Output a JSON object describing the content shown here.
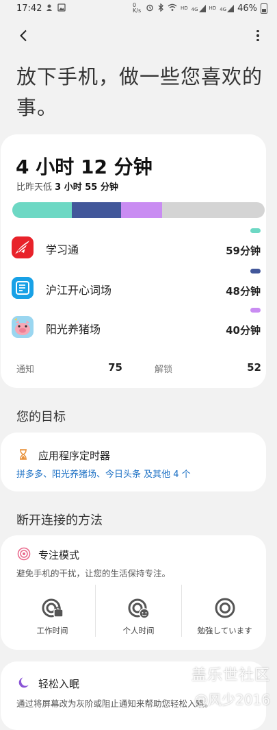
{
  "status_bar": {
    "time": "17:42",
    "net_speed": "0 K/s",
    "hd1": "HD",
    "net1": "4G",
    "hd2": "HD",
    "net2": "4G",
    "battery": "46%"
  },
  "headline": "放下手机，做一些您喜欢的事。",
  "usage": {
    "total": "4 小时 12 分钟",
    "compare_prefix": "比昨天低 ",
    "compare_value": "3 小时 55 分钟",
    "bar": [
      {
        "fraction": 0.236,
        "color": "#6dd8c4"
      },
      {
        "fraction": 0.195,
        "color": "#42579a"
      },
      {
        "fraction": 0.162,
        "color": "#c98cf2"
      }
    ],
    "apps": [
      {
        "name": "学习通",
        "time": "59分钟",
        "color": "#6dd8c4",
        "icon": "xuexitong-icon"
      },
      {
        "name": "沪江开心词场",
        "time": "48分钟",
        "color": "#42579a",
        "icon": "hujiang-icon"
      },
      {
        "name": "阳光养猪场",
        "time": "40分钟",
        "color": "#c98cf2",
        "icon": "pig-farm-icon"
      }
    ],
    "notifications_label": "通知",
    "notifications_value": "75",
    "unlocks_label": "解锁",
    "unlocks_value": "52"
  },
  "goals": {
    "section_title": "您的目标",
    "timer_title": "应用程序定时器",
    "timer_apps": "拼多多、阳光养猪场、今日头条 及其他 4 个"
  },
  "disconnect": {
    "section_title": "断开连接的方法",
    "focus_title": "专注模式",
    "focus_desc": "避免手机的干扰，让您的生活保持专注。",
    "modes": [
      {
        "label": "工作时间",
        "icon": "work-time-icon"
      },
      {
        "label": "个人时间",
        "icon": "personal-time-icon"
      },
      {
        "label": "勉強しています",
        "icon": "study-icon"
      }
    ],
    "sleep_title": "轻松入眠",
    "sleep_desc": "通过将屏幕改为灰阶或阻止通知来帮助您轻松入眠。"
  },
  "watermark": {
    "line1": "盖乐世社区",
    "line2": "@风少2016"
  }
}
